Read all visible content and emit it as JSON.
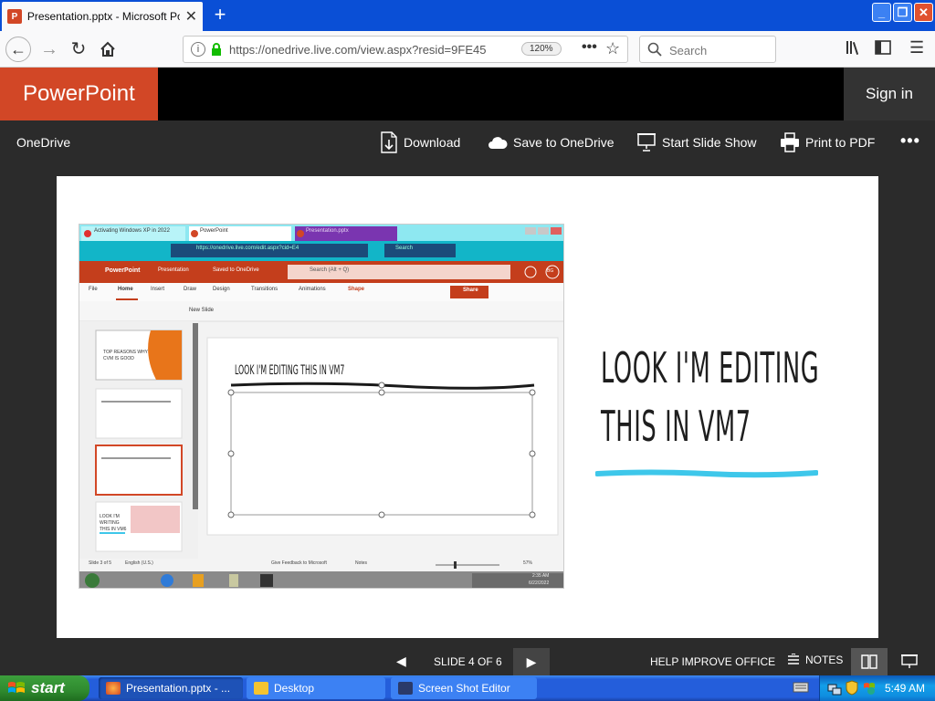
{
  "browser": {
    "tab_title": "Presentation.pptx - Microsoft Pow",
    "tab_favicon_letter": "P",
    "url": "https://onedrive.live.com/view.aspx?resid=9FE45",
    "zoom": "120%",
    "search_placeholder": "Search"
  },
  "app": {
    "brand": "PowerPoint",
    "sign_in": "Sign in",
    "breadcrumb": "OneDrive",
    "commands": {
      "download": "Download",
      "save": "Save to OneDrive",
      "slideshow": "Start Slide Show",
      "print": "Print to PDF"
    }
  },
  "slide": {
    "title_line1": "LOOK I'M EDITING",
    "title_line2": "THIS IN VM7",
    "underline_color": "#3ec7ea",
    "embedded": {
      "tabs": [
        "Activating Windows XP in 2022",
        "PowerPoint",
        "Presentation.pptx"
      ],
      "url": "https://onedrive.live.com/edit.aspx?cid=E4",
      "url_search": "Search",
      "app_name": "PowerPoint",
      "doc_title": "Presentation",
      "doc_state": "Saved to OneDrive",
      "search": "Search (Alt + Q)",
      "avatar": "BG",
      "ribbon_tabs": [
        "File",
        "Home",
        "Insert",
        "Draw",
        "Design",
        "Transitions",
        "Animations",
        "Shape"
      ],
      "share": "Share",
      "new_slide": "New Slide",
      "thumb1_text": "TOP REASONS WHY CVM IS GOOD",
      "thumb4_text": "LOOK I'M WRITING THIS IN VM6",
      "slide_heading": "LOOK I'M EDITING THIS IN VM7",
      "status_left": "Slide 3 of 5",
      "language": "English (U.S.)",
      "feedback": "Give Feedback to Microsoft",
      "notes": "Notes",
      "zoom": "57%",
      "time": "2:35 AM",
      "date": "6/22/2022"
    }
  },
  "statusbar": {
    "counter": "SLIDE 4 OF 6",
    "help": "HELP IMPROVE OFFICE",
    "notes": "NOTES"
  },
  "taskbar": {
    "start": "start",
    "tasks": [
      "Presentation.pptx - ...",
      "Desktop",
      "Screen Shot Editor"
    ],
    "clock": "5:49 AM"
  },
  "colors": {
    "accent": "#d24726",
    "xp_blue": "#245edb",
    "xp_green": "#2f8a2f"
  }
}
